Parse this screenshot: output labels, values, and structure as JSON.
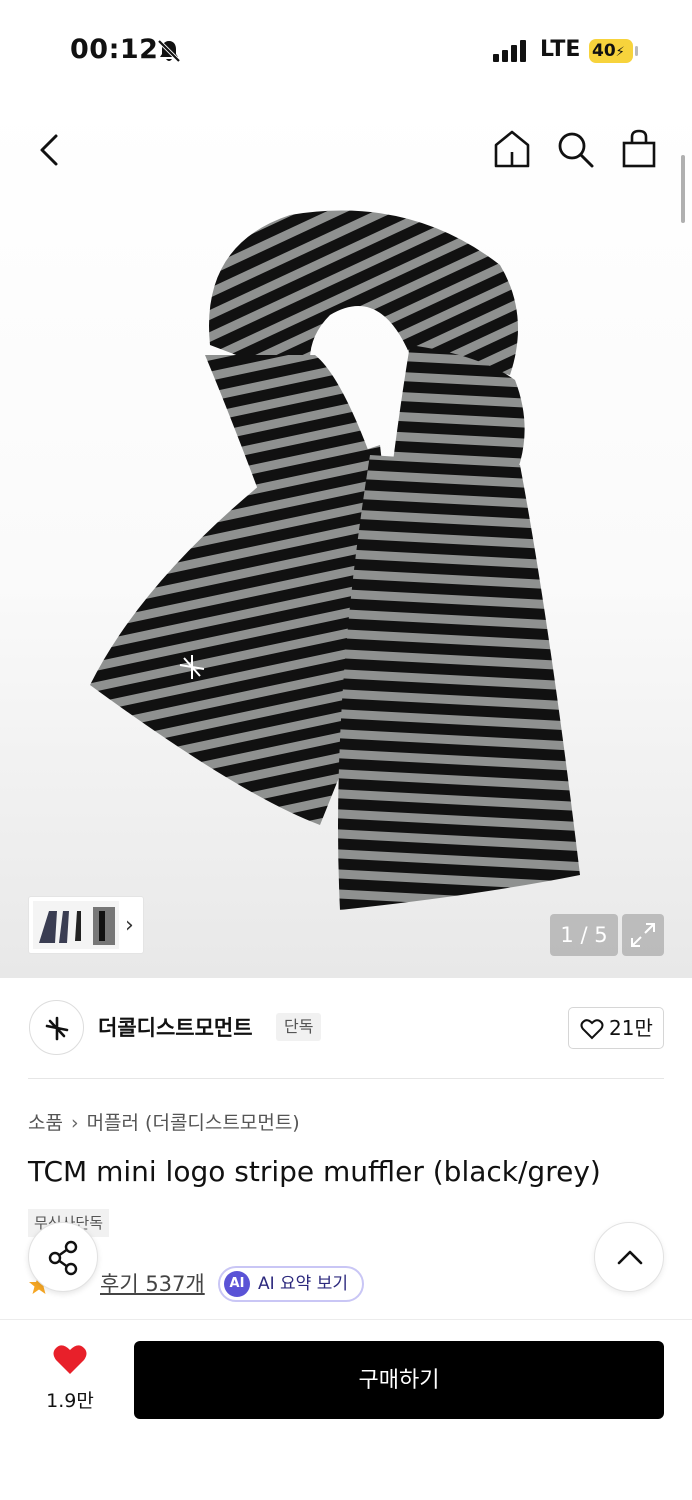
{
  "status_bar": {
    "time": "00:12",
    "network": "LTE",
    "battery": "40"
  },
  "nav": {
    "back_icon": "chevron-left-icon",
    "home_icon": "home-icon",
    "search_icon": "search-icon",
    "bag_icon": "shopping-bag-icon"
  },
  "gallery": {
    "counter": "1 / 5",
    "current_index": 1,
    "total": 5
  },
  "brand": {
    "name": "더콜디스트모먼트",
    "badge": "단독",
    "like_count": "21만"
  },
  "breadcrumb": {
    "category": "소품",
    "subcategory": "머플러 (더콜디스트모먼트)"
  },
  "product": {
    "title": "TCM mini logo stripe muffler (black/grey)",
    "exclusive_badge": "무신사단독",
    "rating": ".9",
    "reviews_label": "후기 537개",
    "ai_badge": "AI",
    "ai_summary_label": "AI 요약 보기"
  },
  "bottom_bar": {
    "wish_count": "1.9만",
    "buy_label": "구매하기"
  },
  "colors": {
    "accent_heart": "#e8202a",
    "buy_button": "#000000",
    "ai_purple": "#5a53d6",
    "star": "#f5a623",
    "battery_yellow": "#f7d33c"
  }
}
